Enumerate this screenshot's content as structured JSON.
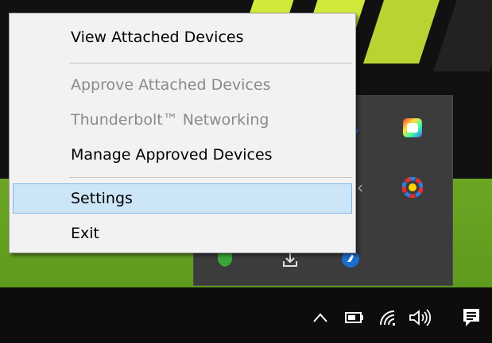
{
  "context_menu": {
    "items": [
      {
        "label": "View Attached Devices",
        "enabled": true
      },
      {
        "label": "Approve Attached Devices",
        "enabled": false
      },
      {
        "label": "Thunderbolt™ Networking",
        "enabled": false
      },
      {
        "label": "Manage Approved Devices",
        "enabled": true
      },
      {
        "label": "Settings",
        "enabled": true,
        "highlighted": true
      },
      {
        "label": "Exit",
        "enabled": true
      }
    ]
  },
  "tray_overflow": {
    "icons": [
      "thunderbolt-icon",
      "color-palette-icon",
      "color-wheel-icon",
      "shield-icon",
      "download-icon",
      "blue-circle-icon"
    ]
  },
  "taskbar": {
    "icons": [
      "chevron-up-icon",
      "battery-icon",
      "wifi-icon",
      "volume-icon",
      "notification-icon"
    ]
  },
  "colors": {
    "menu_background": "#f2f2f2",
    "selection_background": "#cde6f7",
    "selection_border": "#7eb4ea",
    "disabled_text": "#8a8a8a",
    "taskbar": "#0d0d0d",
    "wallpaper_green": "#6fae1d"
  }
}
